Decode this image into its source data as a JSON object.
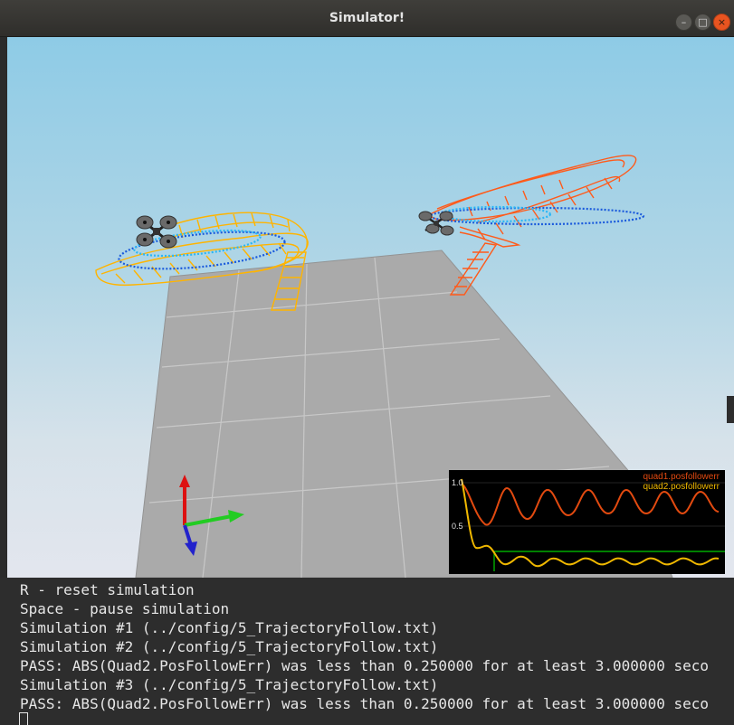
{
  "window": {
    "title": "Simulator!",
    "buttons": {
      "minimize": "–",
      "maximize": "□",
      "close": "×"
    }
  },
  "viewport": {
    "sky_top_color": "#8ecbe6",
    "floor_color": "#a9a9a9",
    "quad1_trail_color": "#ff5a1a",
    "quad2_trail_color": "#ffb400",
    "target_path_color": "#1a5adc",
    "axes": {
      "x_color": "#22cc22",
      "y_color": "#2222cc",
      "z_color": "#dd1111"
    }
  },
  "graph": {
    "legend": [
      "quad1.posfollowerr",
      "quad2.posfollowerr"
    ],
    "ticks": [
      "1.0",
      "0.5"
    ],
    "threshold_color": "#00cc00"
  },
  "terminal": {
    "lines": [
      "R - reset simulation",
      "Space - pause simulation",
      "Simulation #1 (../config/5_TrajectoryFollow.txt)",
      "Simulation #2 (../config/5_TrajectoryFollow.txt)",
      "PASS: ABS(Quad2.PosFollowErr) was less than 0.250000 for at least 3.000000 seco",
      "Simulation #3 (../config/5_TrajectoryFollow.txt)",
      "PASS: ABS(Quad2.PosFollowErr) was less than 0.250000 for at least 3.000000 seco"
    ]
  }
}
